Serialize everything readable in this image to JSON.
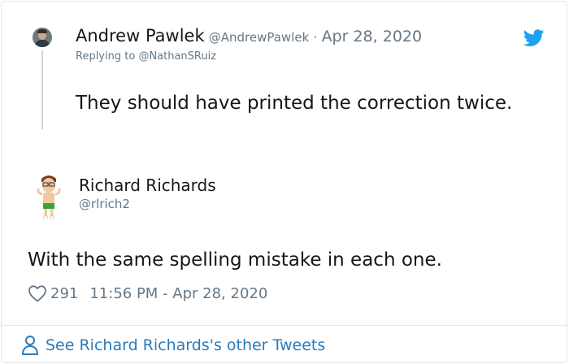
{
  "parent_tweet": {
    "author_name": "Andrew Pawlek",
    "author_handle": "@AndrewPawlek",
    "separator": "·",
    "date": "Apr 28, 2020",
    "reply_prefix": "Replying to",
    "reply_target": "@NathanSRuiz",
    "text": "They should have printed the correction twice."
  },
  "main_tweet": {
    "author_name": "Richard Richards",
    "author_handle": "@rlrich2",
    "text": "With the same spelling mistake in each one.",
    "like_count": "291",
    "timestamp": "11:56 PM - Apr 28, 2020"
  },
  "footer": {
    "link_text": "See Richard Richards's other Tweets"
  },
  "icons": {
    "brand": "twitter-bird-icon",
    "like": "heart-icon",
    "profile": "person-icon"
  },
  "colors": {
    "twitter_blue": "#1da1f2",
    "link": "#2b7bb9",
    "secondary_text": "#657786",
    "primary_text": "#14171a",
    "border": "#e1e8ed"
  }
}
